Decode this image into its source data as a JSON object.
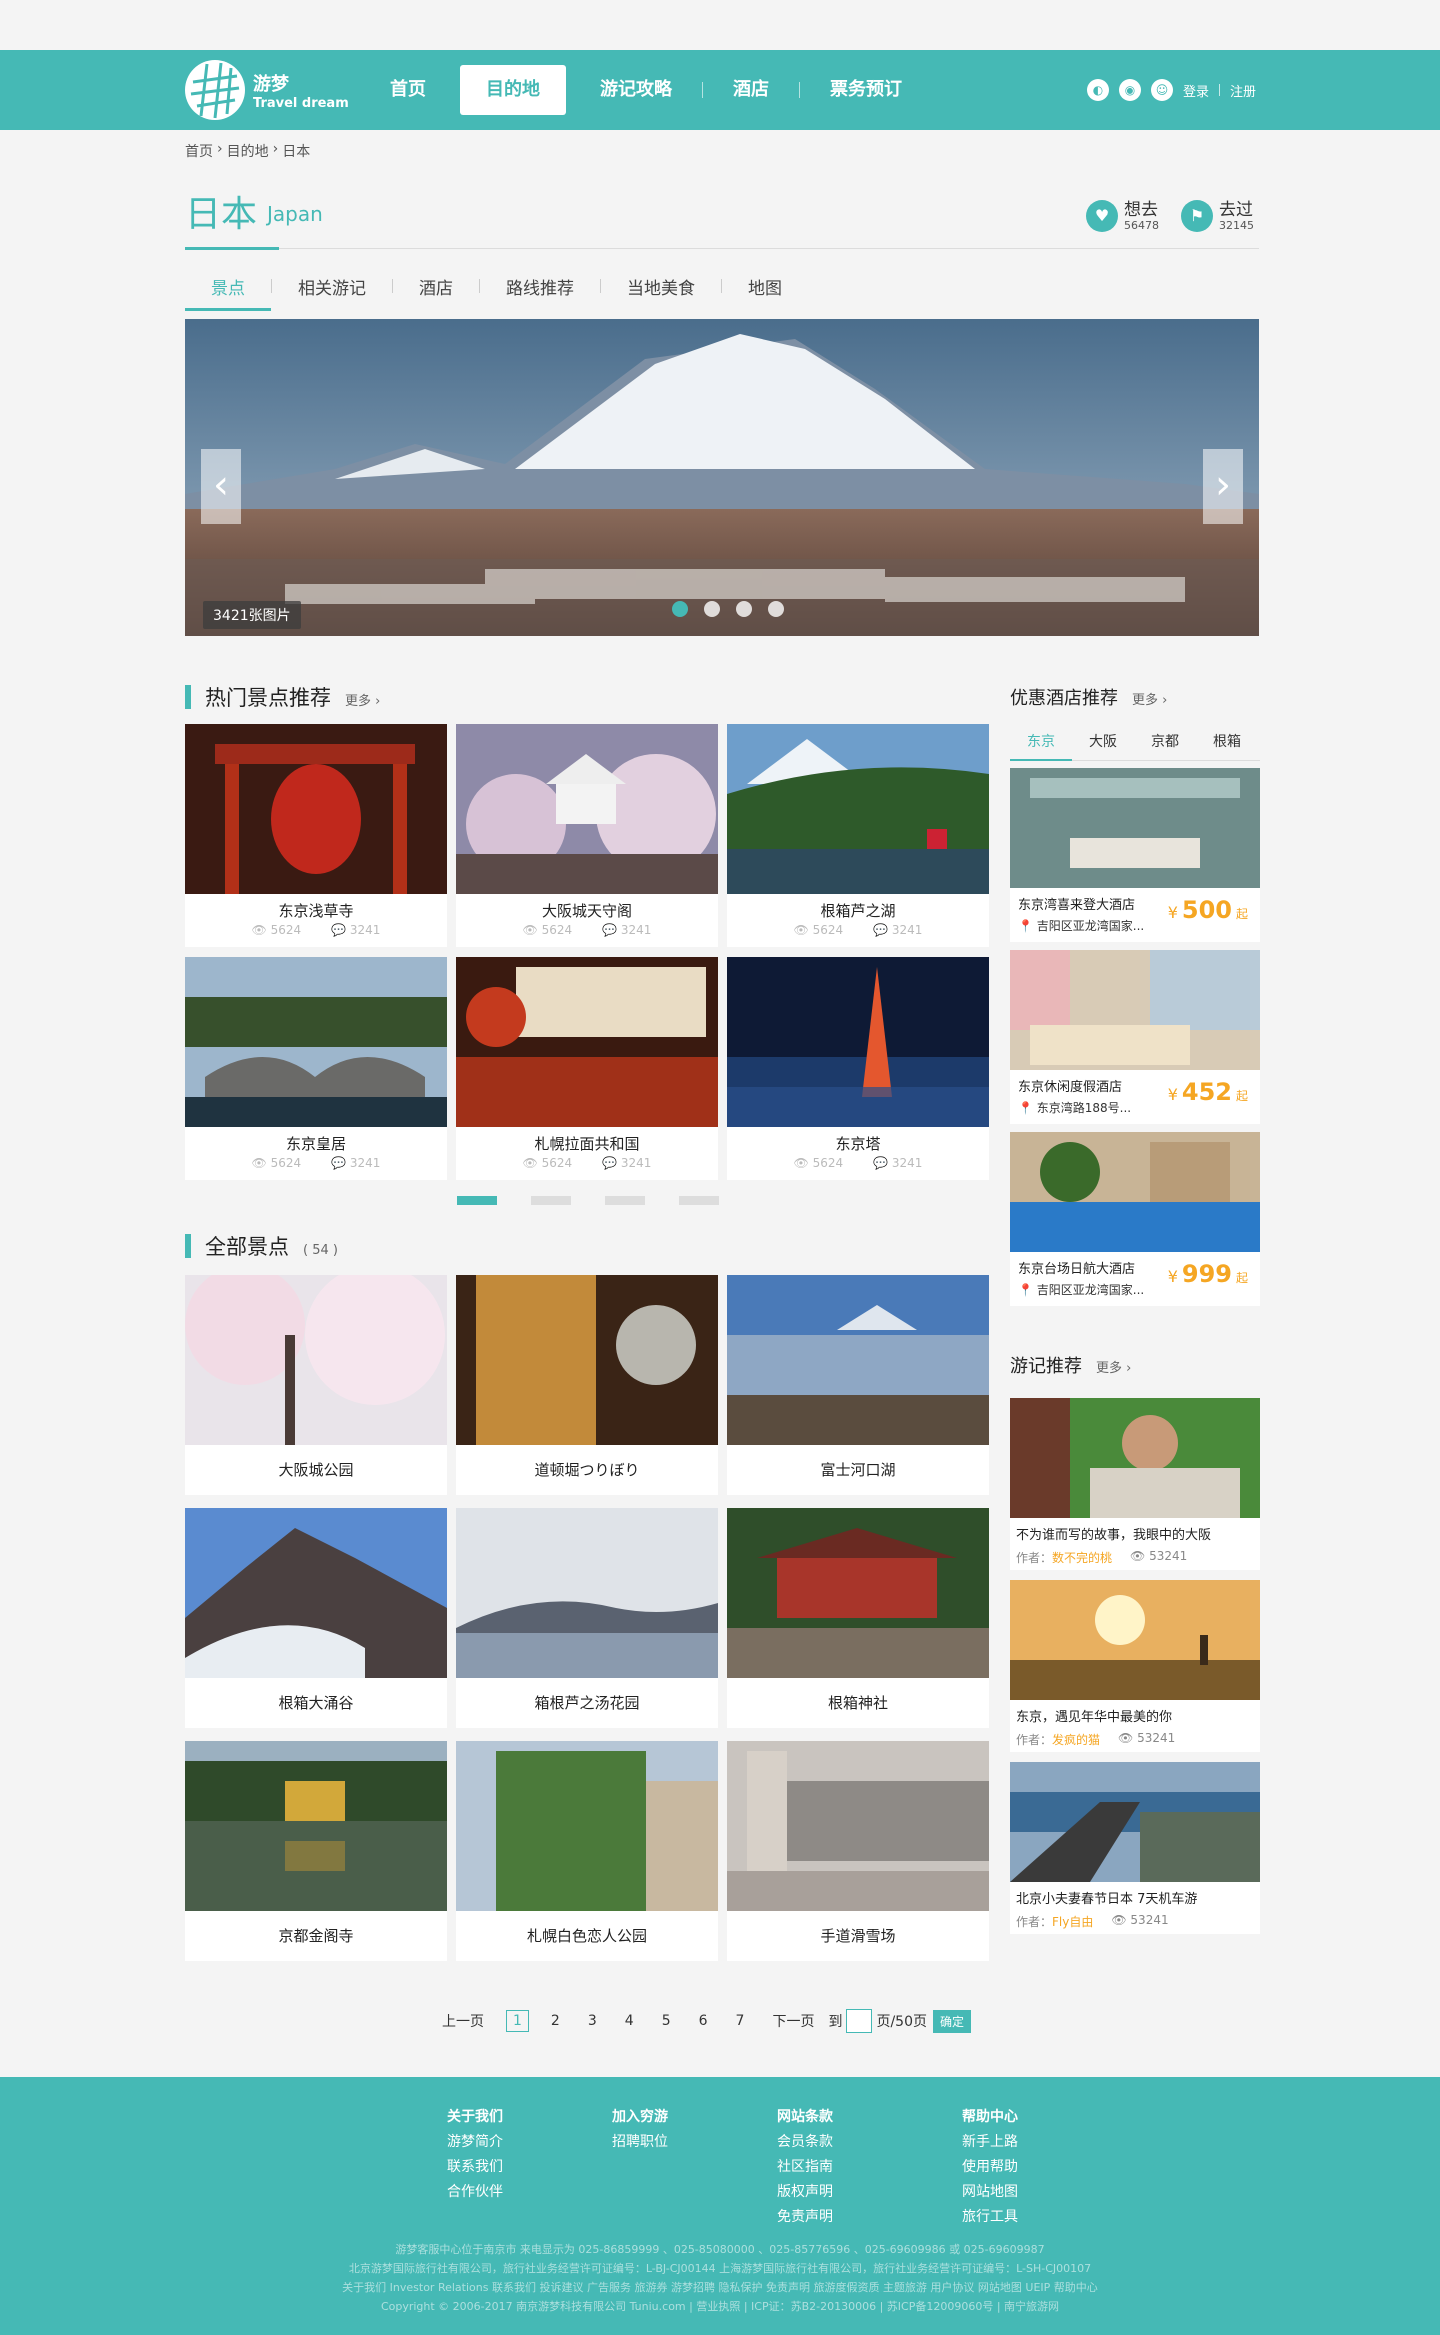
{
  "header": {
    "logo_cn": "游梦",
    "logo_en": "Travel dream",
    "nav": [
      "首页",
      "目的地",
      "游记攻略",
      "酒店",
      "票务预订"
    ],
    "nav_active": 1,
    "login": "登录",
    "register": "注册"
  },
  "breadcrumb": [
    "首页",
    "›",
    "目的地",
    "›",
    "日本"
  ],
  "title": {
    "cn": "日本",
    "en": "Japan",
    "want_label": "想去",
    "want_count": "56478",
    "been_label": "去过",
    "been_count": "32145"
  },
  "subtabs": [
    "景点",
    "相关游记",
    "酒店",
    "路线推荐",
    "当地美食",
    "地图"
  ],
  "banner": {
    "photo_count": "3421张图片",
    "prev": "‹",
    "next": "›"
  },
  "hot": {
    "title": "热门景点推荐",
    "more": "更多 ›",
    "items": [
      {
        "name": "东京浅草寺",
        "views": "5624",
        "comments": "3241"
      },
      {
        "name": "大阪城天守阁",
        "views": "5624",
        "comments": "3241"
      },
      {
        "name": "根箱芦之湖",
        "views": "5624",
        "comments": "3241"
      },
      {
        "name": "东京皇居",
        "views": "5624",
        "comments": "3241"
      },
      {
        "name": "札幌拉面共和国",
        "views": "5624",
        "comments": "3241"
      },
      {
        "name": "东京塔",
        "views": "5624",
        "comments": "3241"
      }
    ]
  },
  "all": {
    "title": "全部景点",
    "count": "( 54 )",
    "items": [
      "大阪城公园",
      "道顿堀つりぼり",
      "富士河口湖",
      "根箱大涌谷",
      "箱根芦之汤花园",
      "根箱神社",
      "京都金阁寺",
      "札幌白色恋人公园",
      "手道滑雪场"
    ]
  },
  "hotels": {
    "title": "优惠酒店推荐",
    "more": "更多 ›",
    "tabs": [
      "东京",
      "大阪",
      "京都",
      "根箱"
    ],
    "items": [
      {
        "name": "东京湾喜来登大酒店",
        "addr": "吉阳区亚龙湾国家...",
        "price": "500",
        "yen": "¥",
        "unit": "起"
      },
      {
        "name": "东京休闲度假酒店",
        "addr": "东京湾路188号...",
        "price": "452",
        "yen": "¥",
        "unit": "起"
      },
      {
        "name": "东京台场日航大酒店",
        "addr": "吉阳区亚龙湾国家...",
        "price": "999",
        "yen": "¥",
        "unit": "起"
      }
    ]
  },
  "journals": {
    "title": "游记推荐",
    "more": "更多 ›",
    "author_prefix": "作者：",
    "items": [
      {
        "title": "不为谁而写的故事，我眼中的大阪",
        "author": "数不完的桃",
        "views": "53241"
      },
      {
        "title": "东京，遇见年华中最美的你",
        "author": "发疯的猫",
        "views": "53241"
      },
      {
        "title": "北京小夫妻春节日本 7天机车游",
        "author": "Fly自由",
        "views": "53241"
      }
    ]
  },
  "pagination": {
    "prev": "上一页",
    "pages": [
      "1",
      "2",
      "3",
      "4",
      "5",
      "6",
      "7"
    ],
    "next": "下一页",
    "goto": "到",
    "total": "页/50页",
    "confirm": "确定"
  },
  "footer": {
    "cols": [
      {
        "head": "关于我们",
        "links": [
          "游梦简介",
          "联系我们",
          "合作伙伴"
        ]
      },
      {
        "head": "加入穷游",
        "links": [
          "招聘职位"
        ]
      },
      {
        "head": "网站条款",
        "links": [
          "会员条款",
          "社区指南",
          "版权声明",
          "免责声明"
        ]
      },
      {
        "head": "帮助中心",
        "links": [
          "新手上路",
          "使用帮助",
          "网站地图",
          "旅行工具"
        ]
      }
    ],
    "info": [
      "游梦客服中心位于南京市 来电显示为 025-86859999 、025-85080000 、025-85776596 、025-69609986 或 025-69609987",
      "北京游梦国际旅行社有限公司，旅行社业务经营许可证编号：L-BJ-CJ00144    上海游梦国际旅行社有限公司，旅行社业务经营许可证编号：L-SH-CJ00107",
      "关于我们 Investor Relations 联系我们 投诉建议 广告服务 旅游券 游梦招聘 隐私保护 免责声明 旅游度假资质 主题旅游 用户协议 网站地图 UEIP 帮助中心",
      "Copyright © 2006-2017 南京游梦科技有限公司 Tuniu.com | 营业执照 | ICP证：苏B2-20130006 | 苏ICP备12009060号 | 南宁旅游网"
    ]
  }
}
